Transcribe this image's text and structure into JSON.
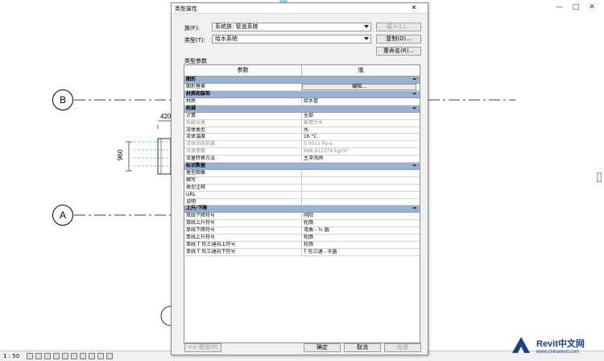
{
  "window": {
    "minimize": "—",
    "maximize": "□",
    "close": "✕"
  },
  "canvas": {
    "grid_b": "B",
    "grid_a": "A",
    "dim_420": "420",
    "dim_960": "960"
  },
  "statusbar": {
    "scale": "1 : 50"
  },
  "logo": {
    "line1": "Revit中文网",
    "line2": "www.chinarevit.com"
  },
  "dialog": {
    "title": "类型属性",
    "close": "✕",
    "family_label": "族(F):",
    "family_value": "系统族: 管道系统",
    "type_label": "类型(T):",
    "type_value": "给水系统",
    "load_button": "载入(L)...",
    "duplicate_button": "复制(D)...",
    "rename_button": "重命名(R)...",
    "section_caption": "类型参数",
    "col_param": "参数",
    "col_value": "值",
    "preview_button": "<< 预览(P)",
    "ok_button": "确定",
    "cancel_button": "取消",
    "apply_button": "应用"
  },
  "categories": [
    {
      "name": "图形",
      "collapse": "≈",
      "rows": [
        {
          "param": "图形替换",
          "value": "",
          "button": "编辑..."
        }
      ]
    },
    {
      "name": "材质和装饰",
      "collapse": "≈",
      "rows": [
        {
          "param": "材质",
          "value": "给水管"
        }
      ]
    },
    {
      "name": "机械",
      "collapse": "≈",
      "rows": [
        {
          "param": "计算",
          "value": "全部"
        },
        {
          "param": "系统分类",
          "value": "家用冷水",
          "grey": true
        },
        {
          "param": "流体类型",
          "value": "水"
        },
        {
          "param": "流体温度",
          "value": "16 °C"
        },
        {
          "param": "流体动态粘度",
          "value": "0.0011 Pa-s",
          "grey": true
        },
        {
          "param": "流体密度",
          "value": "998.911376 kg/m³",
          "grey": true
        },
        {
          "param": "流量转换方法",
          "value": "主冲洗阀"
        }
      ]
    },
    {
      "name": "标识数据",
      "collapse": "≈",
      "rows": [
        {
          "param": "类型图像",
          "value": ""
        },
        {
          "param": "缩写",
          "value": ""
        },
        {
          "param": "类型注释",
          "value": ""
        },
        {
          "param": "URL",
          "value": ""
        },
        {
          "param": "说明",
          "value": ""
        }
      ]
    },
    {
      "name": "上升/下降",
      "collapse": "≈",
      "rows": [
        {
          "param": "双线下降符号",
          "value": "阴阳"
        },
        {
          "param": "双线上升符号",
          "value": "轮廓"
        },
        {
          "param": "单线下降符号",
          "value": "弯曲 - ¾ 圆"
        },
        {
          "param": "单线上升符号",
          "value": "轮廓"
        },
        {
          "param": "单线 T 形三通向上符号",
          "value": "轮廓"
        },
        {
          "param": "单线 T 形三通向下符号",
          "value": "T 形三通 - 半圆"
        }
      ]
    }
  ]
}
